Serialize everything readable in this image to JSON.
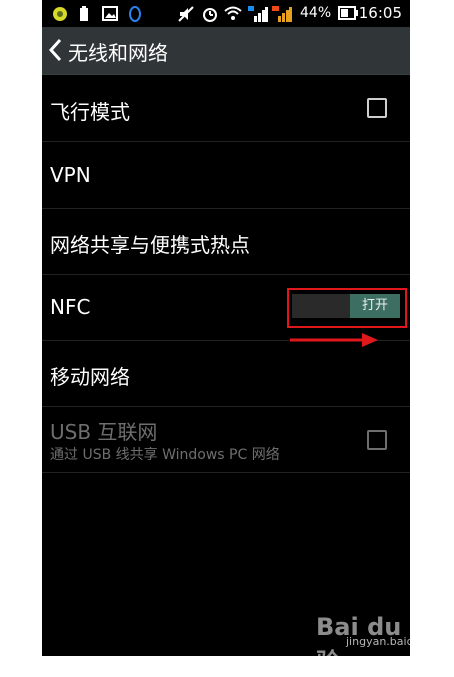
{
  "status_bar": {
    "icons": [
      "app-icon",
      "battery-saver-icon",
      "gallery-icon",
      "qq-icon",
      "mute-icon",
      "alarm-icon",
      "wifi-icon",
      "signal-icon",
      "signal-3g-icon",
      "battery-icon"
    ],
    "battery_percent": "44%",
    "time": "16:05"
  },
  "action_bar": {
    "title": "无线和网络",
    "back_icon": "chevron-left-icon"
  },
  "settings": {
    "airplane": {
      "label": "飞行模式",
      "checked": false
    },
    "vpn": {
      "label": "VPN"
    },
    "tethering": {
      "label": "网络共享与便携式热点"
    },
    "nfc": {
      "label": "NFC",
      "toggle_label": "打开",
      "toggle_on": true
    },
    "mobile_network": {
      "label": "移动网络"
    },
    "usb_internet": {
      "label": "USB 互联网",
      "summary": "通过 USB 线共享 Windows PC 网络",
      "checked": false,
      "enabled": false
    }
  },
  "annotation": {
    "highlight_color": "#e0181b"
  },
  "watermark": {
    "brand": "Bai du 经验",
    "url": "jingyan.baidu.com"
  },
  "colors": {
    "accent_toggle": "#3d6e62",
    "action_bar": "#303538"
  }
}
